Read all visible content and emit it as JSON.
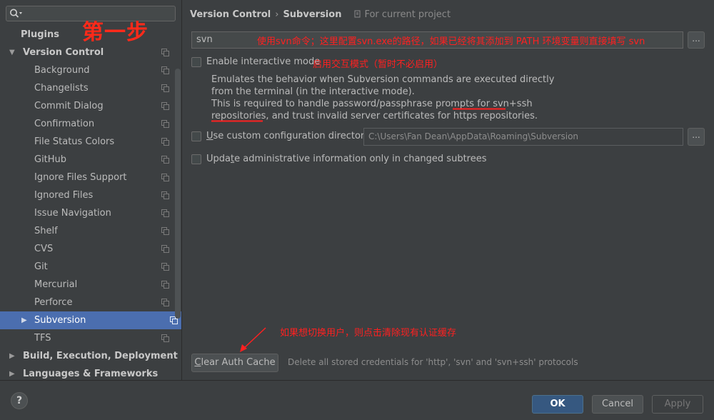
{
  "search": {
    "placeholder": ""
  },
  "annotations": {
    "step": "第一步",
    "svn_note": "使用svn命令；这里配置svn.exe的路径，如果已经将其添加到 PATH 环境变量则直接填写 svn",
    "interactive_note": "启用交互模式（暂时不必启用）",
    "clear_cache_note": "如果想切换用户，则点击清除现有认证缓存"
  },
  "sidebar": {
    "items": [
      {
        "label": "Plugins",
        "level": 0
      },
      {
        "label": "Version Control",
        "level": 0,
        "expanded": true
      },
      {
        "label": "Background",
        "level": 1
      },
      {
        "label": "Changelists",
        "level": 1
      },
      {
        "label": "Commit Dialog",
        "level": 1
      },
      {
        "label": "Confirmation",
        "level": 1
      },
      {
        "label": "File Status Colors",
        "level": 1
      },
      {
        "label": "GitHub",
        "level": 1
      },
      {
        "label": "Ignore Files Support",
        "level": 1
      },
      {
        "label": "Ignored Files",
        "level": 1
      },
      {
        "label": "Issue Navigation",
        "level": 1
      },
      {
        "label": "Shelf",
        "level": 1
      },
      {
        "label": "CVS",
        "level": 1
      },
      {
        "label": "Git",
        "level": 1
      },
      {
        "label": "Mercurial",
        "level": 1
      },
      {
        "label": "Perforce",
        "level": 1
      },
      {
        "label": "Subversion",
        "level": 1,
        "selected": true
      },
      {
        "label": "TFS",
        "level": 1
      },
      {
        "label": "Build, Execution, Deployment",
        "level": 0
      },
      {
        "label": "Languages & Frameworks",
        "level": 0
      }
    ]
  },
  "breadcrumb": {
    "parent": "Version Control",
    "current": "Subversion",
    "scope": "For current project"
  },
  "svn": {
    "path_value": "svn",
    "browse": "...",
    "interactive_label": "Enable interactive mode",
    "interactive_checked": false,
    "desc_lines": [
      "Emulates the behavior when Subversion commands are executed directly",
      "from the terminal (in the interactive mode).",
      "This is required to handle password/passphrase prompts for svn+ssh",
      "repositories, and trust invalid server certificates for https repositories."
    ],
    "config_dir_label_u": "U",
    "config_dir_label_rest": "se custom configuration directory:",
    "config_dir_checked": false,
    "config_dir_value": "C:\\Users\\Fan Dean\\AppData\\Roaming\\Subversion",
    "update_label_pre": "Upda",
    "update_label_u": "t",
    "update_label_post": "e administrative information only in changed subtrees",
    "update_checked": false,
    "clear_cache_u": "C",
    "clear_cache_rest": "lear Auth Cache",
    "clear_cache_desc": "Delete all stored credentials for 'http', 'svn' and 'svn+ssh' protocols"
  },
  "dialog": {
    "ok": "OK",
    "cancel": "Cancel",
    "apply": "Apply",
    "help": "?"
  },
  "colors": {
    "accent_selected": "#4b6eaf",
    "annotation_red": "#ff2020",
    "ok_button": "#365880"
  }
}
